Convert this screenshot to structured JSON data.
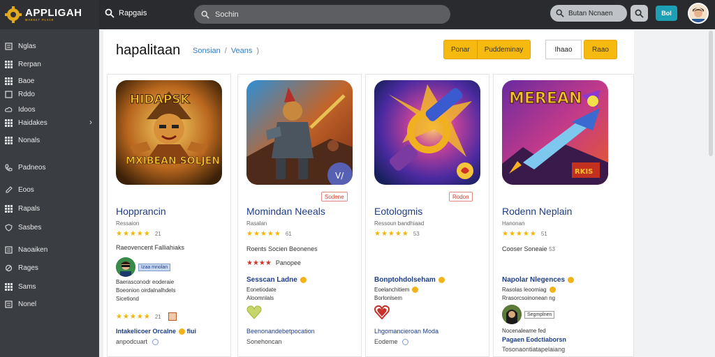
{
  "app": {
    "logo_title": "APPLIGAH",
    "logo_sub": "ᴍᴀʀᴋᴇᴛ ᴘʟᴀᴄᴇ",
    "top_title": "Rapgais",
    "search_placeholder": "Sochin",
    "search2_placeholder": "Butan Ncnaen",
    "new_label": "Bol",
    "accent": "#f6b90f",
    "teal": "#1ba0b5"
  },
  "sidebar": {
    "items": [
      {
        "label": "Nglas",
        "icon": "doc-icon"
      },
      {
        "label": "Rerpan",
        "icon": "grid-icon"
      },
      {
        "label": "Baoe",
        "icon": "grid-icon"
      },
      {
        "label": "Rddo",
        "icon": "square-icon"
      },
      {
        "label": "Idoos",
        "icon": "cloud-icon"
      },
      {
        "label": "Haidakes",
        "icon": "grid-icon",
        "chevron": "›"
      },
      {
        "label": "Nonals",
        "icon": "grid-icon"
      },
      {
        "label": "Padneos",
        "icon": "phone-icon"
      },
      {
        "label": "Eoos",
        "icon": "edit-icon"
      },
      {
        "label": "Rapals",
        "icon": "grid-icon"
      },
      {
        "label": "Sasbes",
        "icon": "shield-icon"
      },
      {
        "label": "Naoaiken",
        "icon": "doc-icon"
      },
      {
        "label": "Rages",
        "icon": "circle-icon"
      },
      {
        "label": "Sams",
        "icon": "grid-icon"
      },
      {
        "label": "Nonel",
        "icon": "doc-icon"
      }
    ]
  },
  "main": {
    "title": "hapalitaan",
    "breadcrumb": [
      "Sonsian",
      "Veans"
    ],
    "filters": [
      "Ponar",
      "Puddeminay"
    ],
    "sort_label": "Ihaao",
    "apply_label": "Raao"
  },
  "cards": [
    {
      "art_top": "HIDAPSK",
      "art_bottom": "MXIBEAN SOLJEN",
      "tag": "",
      "title": "Hopprancin",
      "sub": "Ressaion",
      "stars": "★★★★★",
      "star_count": "21",
      "meta1": "Raeovencent Falliahiaks",
      "badge": "Izaa mnolan",
      "desc1": "Baerasconodr eoderaie",
      "desc2": "Boeonion oirdalnalhdels",
      "desc3": "Sicetiond",
      "bottom_count": "21",
      "link1": "Intakelicoer Orcalne",
      "link1_tail": "fiui",
      "link2": "anpodcuart"
    },
    {
      "art_top": "",
      "art_bottom": "",
      "tag": "Sodene",
      "title": "Momindan Neeals",
      "sub": "Rasalan",
      "stars": "★★★★★",
      "star_count": "61",
      "meta1": "Roents Socien Beonenes",
      "rating_red": "★★★★",
      "rating_text": "Panopee",
      "highlight": "Sesscan Ladne",
      "desc1": "Eonetiodate",
      "desc2": "Aloomnlals",
      "link1": "Beenonandebetpocation",
      "link1_tail": "",
      "link2": "Sonehoncan"
    },
    {
      "art_top": "",
      "art_bottom": "",
      "tag": "Rodon",
      "title": "Eotologmis",
      "sub": "Ressoun bandhiaad",
      "stars": "★★★★★",
      "star_count": "53",
      "meta1": "",
      "highlight": "Bonptohdolseham",
      "desc1": "Eoelanchitiem",
      "desc2": "Borlonlsem",
      "link1": "Lhgomancieroan Moda",
      "link1_tail": "",
      "link2": "Eodeme"
    },
    {
      "art_top": "MEREAN",
      "art_bottom": "",
      "tag": "",
      "title": "Rodenn Neplain",
      "sub": "Hanonan",
      "stars": "★★★★★",
      "star_count": "51",
      "meta1": "Cooser Soneaie",
      "meta1_tail": "53",
      "highlight": "Napolar Nlegences",
      "desc1": "Rasolas leoomiag",
      "desc2": "Rrasorcsoinonean ng",
      "badge": "Segmplnen",
      "desc3": "Nocenaleame fed",
      "link1": "Pagaen Eodctiaborsn",
      "link1_tail": "",
      "link2": "Tosonaontiatapelaiang"
    }
  ]
}
